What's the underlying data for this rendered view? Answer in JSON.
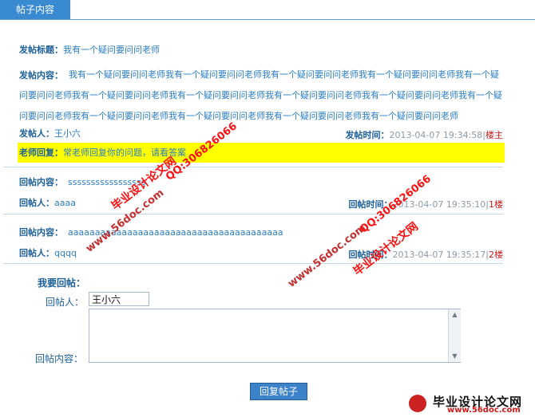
{
  "tab": {
    "label": "帖子内容"
  },
  "post": {
    "title_label": "发帖标题：",
    "title": "我有一个疑问要问问老师",
    "content_label": "发帖内容：",
    "content": "我有一个疑问要问问老师我有一个疑问要问问老师我有一个疑问要问问老师我有一个疑问要问问老师我有一个疑问要问问老师我有一个疑问要问问老师我有一个疑问要问问老师我有一个疑问要问问老师我有一个疑问要问问老师我有一个疑问要问问老师我有一个疑问要问问老师我有一个疑问要问问老师我有一个疑问要问问老师我有一个疑问要问问老师",
    "author_label": "发帖人：",
    "author": "王小六",
    "time_label": "发帖时间：",
    "time": "2013-04-07 19:34:58",
    "sep": "|",
    "floor": "楼主",
    "teacher_label": "老师回复：",
    "teacher_reply": "常老师回复你的问题，请看答案"
  },
  "replies": [
    {
      "content_label": "回帖内容：",
      "content": "sssssssssssssssss",
      "author_label": "回帖人：",
      "author": "aaaa",
      "time_label": "回帖时间：",
      "time": "2013-04-07 19:35:10",
      "sep": "|",
      "floor": "1楼"
    },
    {
      "content_label": "回帖内容：",
      "content": "aaaaaaaaaaaaaaaaaaaaaaaaaaaaaaaaaaaaaaaa",
      "author_label": "回帖人：",
      "author": "qqqq",
      "time_label": "回帖时间：",
      "time": "2013-04-07 19:35:17",
      "sep": "|",
      "floor": "2楼"
    }
  ],
  "form": {
    "title": "我要回帖：",
    "name_label": "回帖人：",
    "name_value": "王小六",
    "content_label": "回帖内容：",
    "submit_label": "回复帖子"
  },
  "watermarks": {
    "a": "毕业设计论文网",
    "b": "www.56doc.com",
    "c": "QQ:306826066"
  },
  "logo": {
    "title": "毕业设计论文网",
    "url": "www.56doc.com"
  },
  "colors": {
    "accent": "#3a8ad1",
    "highlight": "#ffff00",
    "floor_red": "#d01818"
  }
}
